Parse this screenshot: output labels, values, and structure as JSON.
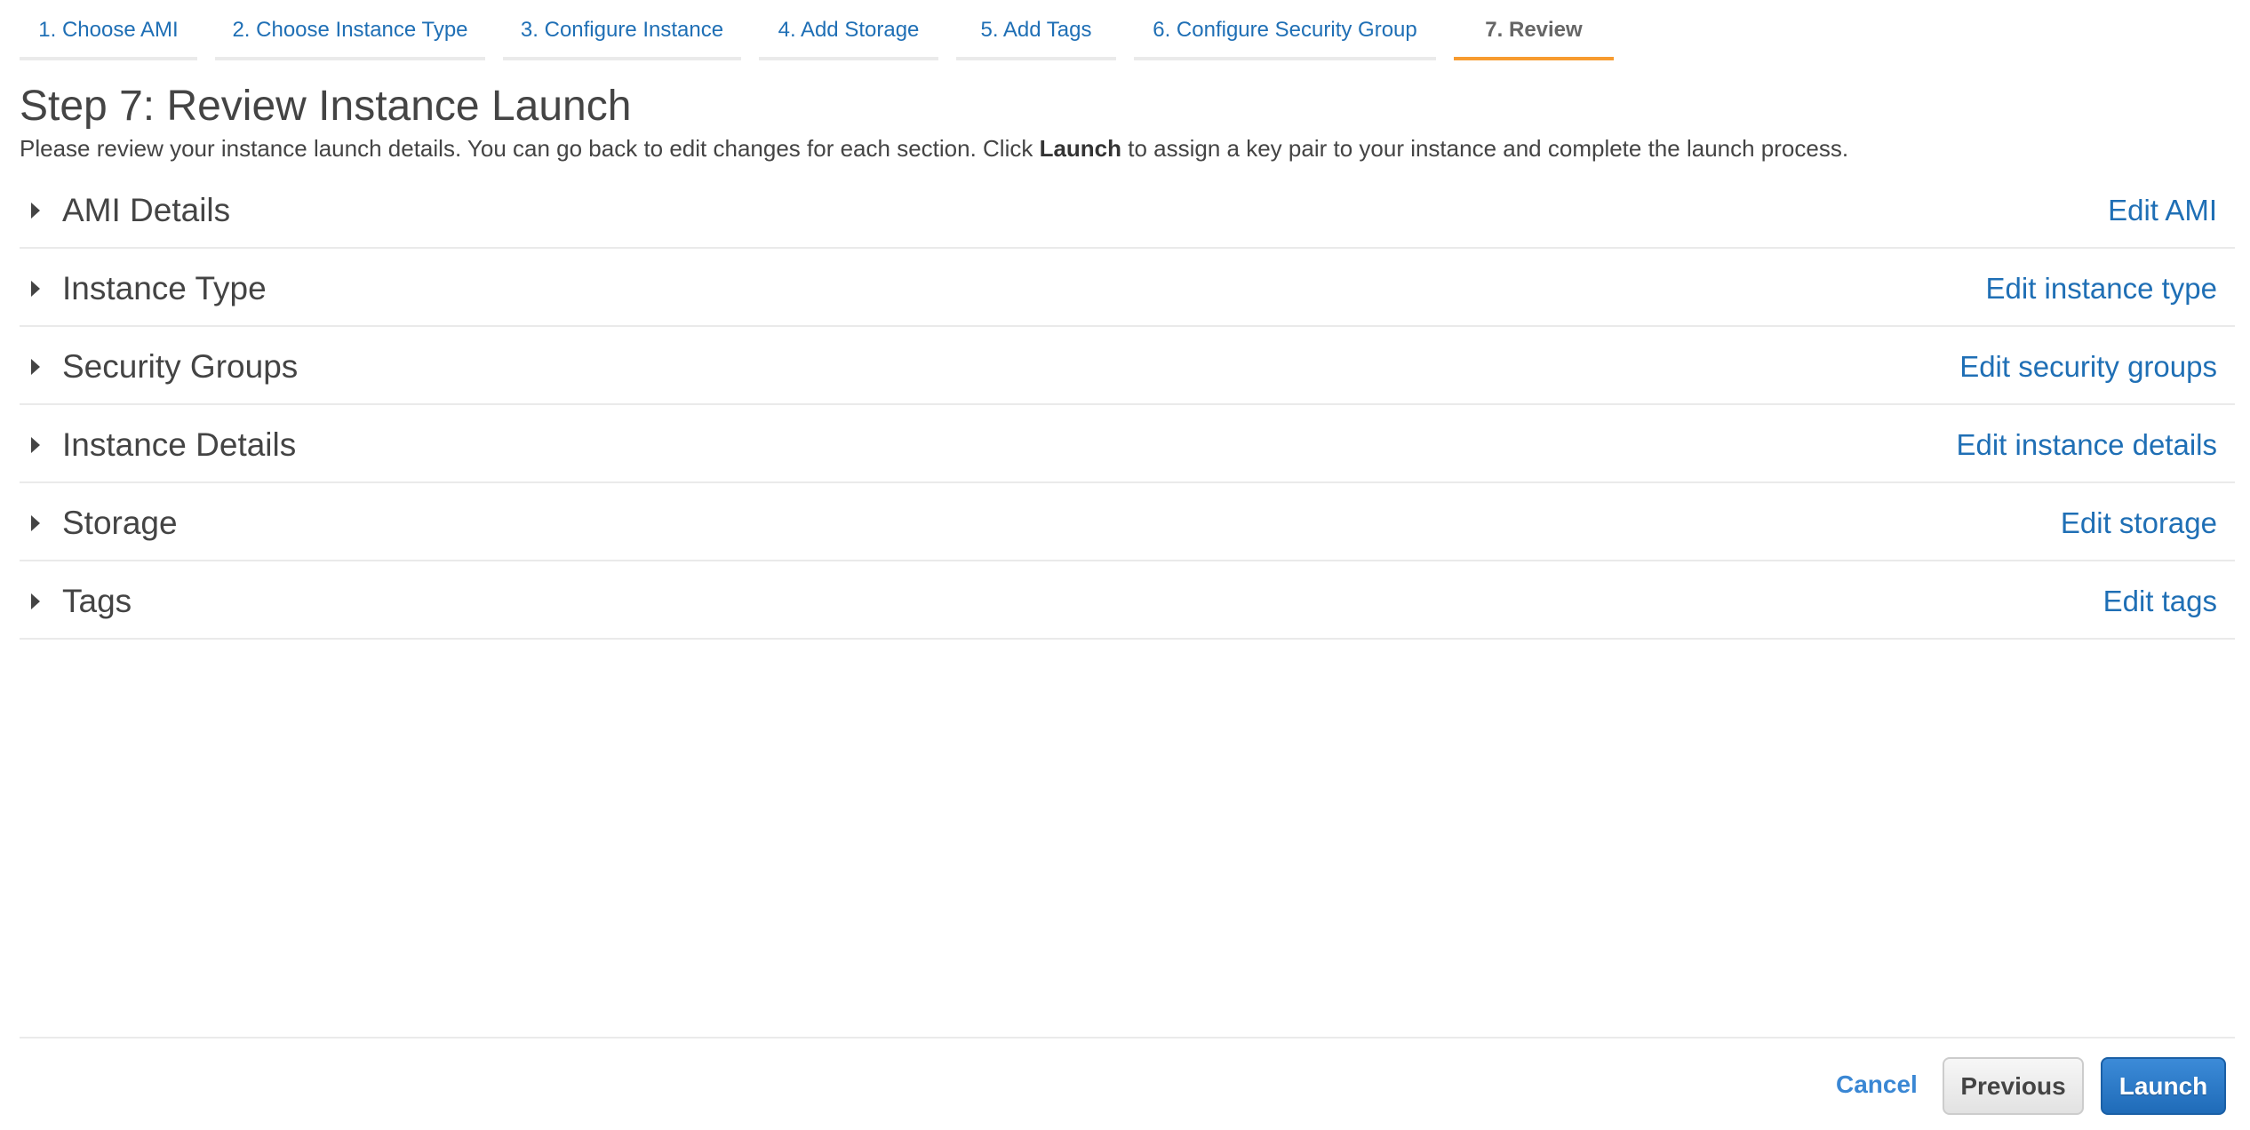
{
  "wizard": {
    "tabs": [
      {
        "label": "1. Choose AMI",
        "active": false
      },
      {
        "label": "2. Choose Instance Type",
        "active": false
      },
      {
        "label": "3. Configure Instance",
        "active": false
      },
      {
        "label": "4. Add Storage",
        "active": false
      },
      {
        "label": "5. Add Tags",
        "active": false
      },
      {
        "label": "6. Configure Security Group",
        "active": false
      },
      {
        "label": "7. Review",
        "active": true
      }
    ],
    "active_color": "#f79b2f",
    "link_color": "#1f6fb5"
  },
  "header": {
    "title": "Step 7: Review Instance Launch",
    "desc_before": "Please review your instance launch details. You can go back to edit changes for each section. Click ",
    "desc_bold": "Launch",
    "desc_after": " to assign a key pair to your instance and complete the launch process."
  },
  "sections": [
    {
      "title": "AMI Details",
      "edit": "Edit AMI"
    },
    {
      "title": "Instance Type",
      "edit": "Edit instance type"
    },
    {
      "title": "Security Groups",
      "edit": "Edit security groups"
    },
    {
      "title": "Instance Details",
      "edit": "Edit instance details"
    },
    {
      "title": "Storage",
      "edit": "Edit storage"
    },
    {
      "title": "Tags",
      "edit": "Edit tags"
    }
  ],
  "footer": {
    "cancel": "Cancel",
    "previous": "Previous",
    "launch": "Launch"
  }
}
